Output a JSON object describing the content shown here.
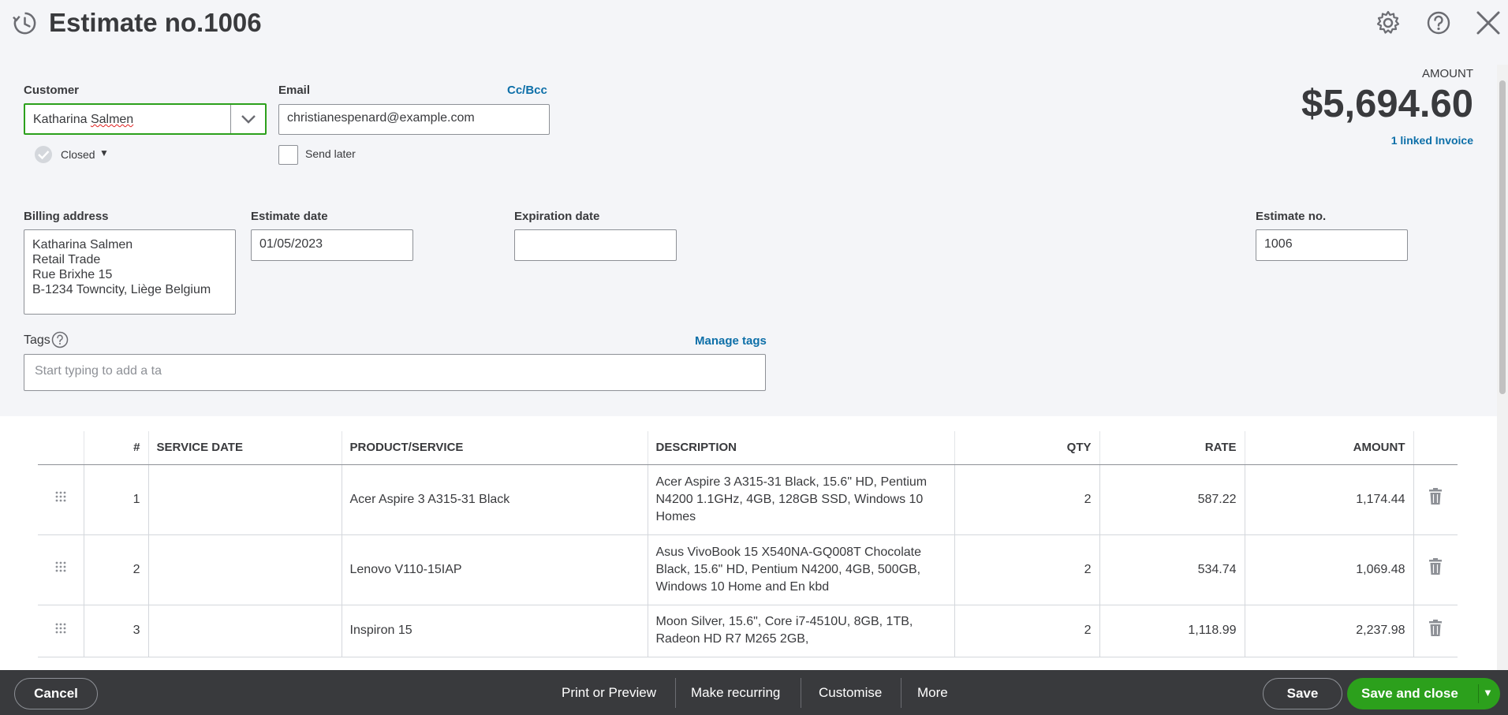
{
  "header": {
    "title": "Estimate no.1006"
  },
  "customer": {
    "label": "Customer",
    "value_first": "Katharina",
    "value_last": "Salmen",
    "status": "Closed"
  },
  "email": {
    "label": "Email",
    "cc_bcc": "Cc/Bcc",
    "value": "christianespenard@example.com",
    "send_later": "Send later"
  },
  "amount": {
    "label": "AMOUNT",
    "value": "$5,694.60",
    "linked": "1 linked Invoice"
  },
  "billing": {
    "label": "Billing address",
    "lines": [
      "Katharina Salmen",
      "Retail Trade",
      "Rue Brixhe 15",
      "B-1234 Towncity, Liège Belgium"
    ]
  },
  "estimate_date": {
    "label": "Estimate date",
    "value": "01/05/2023"
  },
  "expiration_date": {
    "label": "Expiration date",
    "value": ""
  },
  "estimate_no": {
    "label": "Estimate no.",
    "value": "1006"
  },
  "tags": {
    "label": "Tags",
    "manage": "Manage tags",
    "placeholder": "Start typing to add a ta"
  },
  "table": {
    "headers": {
      "num": "#",
      "service_date": "SERVICE DATE",
      "product": "PRODUCT/SERVICE",
      "description": "DESCRIPTION",
      "qty": "QTY",
      "rate": "RATE",
      "amount": "AMOUNT"
    },
    "rows": [
      {
        "num": "1",
        "service_date": "",
        "product": "Acer Aspire 3 A315-31 Black",
        "description": "Acer Aspire 3 A315-31 Black, 15.6\" HD, Pentium N4200 1.1GHz, 4GB, 128GB SSD, Windows 10 Homes",
        "qty": "2",
        "rate": "587.22",
        "amount": "1,174.44"
      },
      {
        "num": "2",
        "service_date": "",
        "product": "Lenovo V110-15IAP",
        "description": "Asus VivoBook 15 X540NA-GQ008T Chocolate Black, 15.6\" HD, Pentium N4200, 4GB, 500GB, Windows 10 Home and En kbd",
        "qty": "2",
        "rate": "534.74",
        "amount": "1,069.48"
      },
      {
        "num": "3",
        "service_date": "",
        "product": "Inspiron 15",
        "description": "Moon Silver, 15.6\", Core i7-4510U, 8GB, 1TB, Radeon HD R7 M265 2GB,",
        "qty": "2",
        "rate": "1,118.99",
        "amount": "2,237.98"
      }
    ]
  },
  "footer": {
    "cancel": "Cancel",
    "print": "Print or Preview",
    "recurring": "Make recurring",
    "customise": "Customise",
    "more": "More",
    "save": "Save",
    "save_close": "Save and close"
  }
}
